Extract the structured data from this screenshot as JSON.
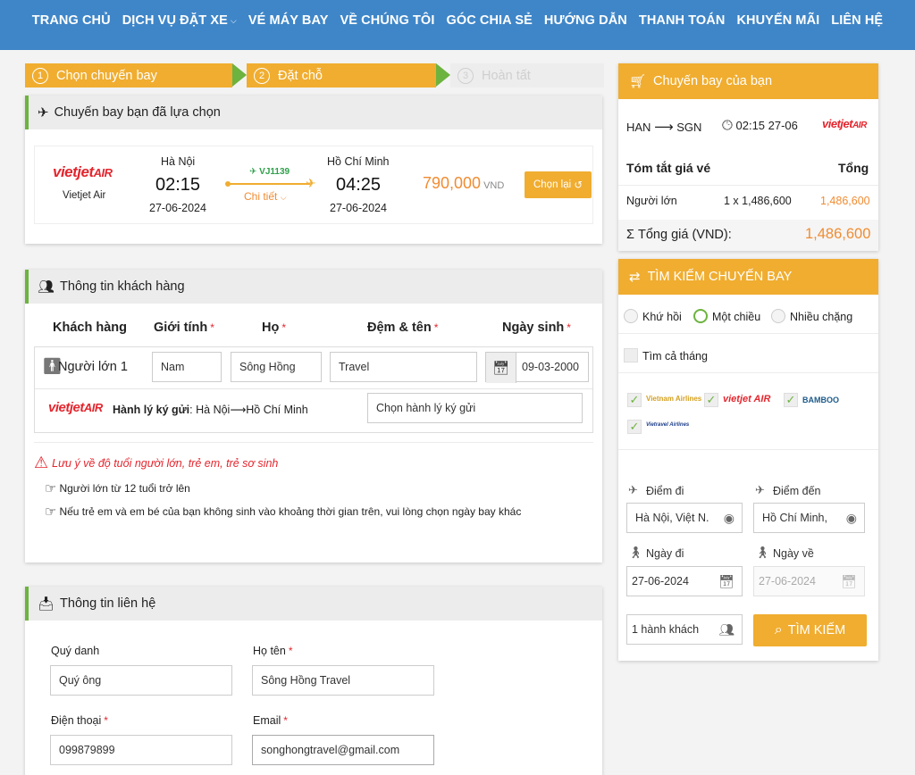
{
  "nav": [
    "TRANG CHỦ",
    "DỊCH VỤ ĐẶT XE",
    "VÉ MÁY BAY",
    "VỀ CHÚNG TÔI",
    "GÓC CHIA SẺ",
    "HƯỚNG DẪN",
    "THANH TOÁN",
    "KHUYẾN MÃI",
    "LIÊN HỆ"
  ],
  "steps": [
    {
      "num": "1",
      "label": "Chọn chuyến bay"
    },
    {
      "num": "2",
      "label": "Đặt chỗ"
    },
    {
      "num": "3",
      "label": "Hoàn tất"
    }
  ],
  "flight": {
    "title": "Chuyến bay bạn đã lựa chọn",
    "logo_text": "vietjet",
    "logo_text2": "AIR",
    "airline": "Vietjet Air",
    "from_city": "Hà Nội",
    "dep_time": "02:15",
    "dep_date": "27-06-2024",
    "code": "VJ1139",
    "detail": "Chi tiết",
    "to_city": "Hồ Chí Minh",
    "arr_time": "04:25",
    "arr_date": "27-06-2024",
    "price": "790,000",
    "currency": "VND",
    "rechoose": "Chọn lại"
  },
  "customer": {
    "title": "Thông tin khách hàng",
    "headers": {
      "type": "Khách hàng",
      "gender": "Giới tính",
      "last": "Họ",
      "first": "Đệm & tên",
      "dob": "Ngày sinh"
    },
    "row": {
      "label": "Người lớn 1",
      "gender": "Nam",
      "last": "Sông Hồng",
      "first": "Travel",
      "dob": "09-03-2000"
    },
    "baggage_label": "Hành lý ký gửi",
    "baggage_route": ": Hà Nội⟶Hồ Chí Minh",
    "baggage_select": "Chọn hành lý ký gửi",
    "warning": "Lưu ý về độ tuổi người lớn, trẻ em, trẻ sơ sinh",
    "note1": "Người lớn từ 12 tuổi trở lên",
    "note2": "Nếu trẻ em và em bé của bạn không sinh vào khoảng thời gian trên, vui lòng chọn ngày bay khác"
  },
  "contact": {
    "title": "Thông tin liên hệ",
    "salutation_label": "Quý danh",
    "salutation_value": "Quý ông",
    "name_label": "Họ tên",
    "name_value": "Sông Hồng Travel",
    "phone_label": "Điện thoại",
    "phone_value": "099879899",
    "email_label": "Email",
    "email_value": "songhongtravel@gmail.com"
  },
  "your_flight": {
    "title": "Chuyến bay của bạn",
    "from": "HAN",
    "to": "SGN",
    "time": "02:15 27-06",
    "summary_label": "Tóm tắt giá vé",
    "total_label": "Tổng",
    "pax_label": "Người lớn",
    "pax_calc": "1 x 1,486,600",
    "pax_total": "1,486,600",
    "grand_label": "Σ Tổng giá (VND):",
    "grand_total": "1,486,600"
  },
  "search": {
    "title": "TÌM KIẾM CHUYẾN BAY",
    "trip_round": "Khứ hồi",
    "trip_oneway": "Một chiều",
    "trip_multi": "Nhiều chặng",
    "whole_month": "Tìm cả tháng",
    "airlines": [
      "Vietnam Airlines",
      "vietjet AIR",
      "BAMBOO",
      "Vietravel Airlines"
    ],
    "from_label": "Điểm đi",
    "from_value": "Hà Nội, Việt N.",
    "to_label": "Điểm đến",
    "to_value": "Hồ Chí Minh,",
    "depart_label": "Ngày đi",
    "depart_value": "27-06-2024",
    "return_label": "Ngày về",
    "return_value": "27-06-2024",
    "pax_value": "1  hành khách",
    "button": "TÌM KIẾM"
  },
  "colors": {
    "nav": "#3f86c8",
    "accent": "#f0ad30",
    "green": "#6db33f",
    "price": "#f08c32",
    "red": "#e3262e"
  }
}
